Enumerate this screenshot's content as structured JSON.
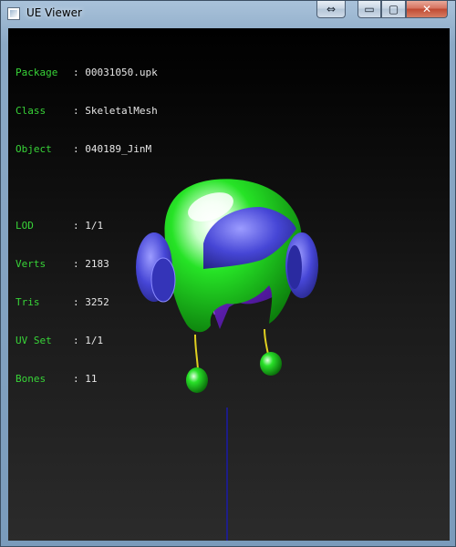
{
  "window": {
    "title": "UE Viewer",
    "controls": {
      "restore_swap": "⇔",
      "minimize": "▭",
      "maximize": "▢",
      "close": "✕"
    }
  },
  "info": {
    "object_block": [
      {
        "label": "Package",
        "sep": ":",
        "value": "00031050.upk"
      },
      {
        "label": "Class",
        "sep": ":",
        "value": "SkeletalMesh"
      },
      {
        "label": "Object",
        "sep": ":",
        "value": "040189_JinM"
      }
    ],
    "stats_block": [
      {
        "label": "LOD",
        "sep": ":",
        "value": "1/1"
      },
      {
        "label": "Verts",
        "sep": ":",
        "value": "2183"
      },
      {
        "label": "Tris",
        "sep": ":",
        "value": "3252"
      },
      {
        "label": "UV Set",
        "sep": ":",
        "value": "1/1"
      },
      {
        "label": "Bones",
        "sep": ":",
        "value": "11"
      }
    ]
  },
  "colors": {
    "label_green": "#38d438",
    "value_white": "#e6e6e6",
    "mesh_green": "#1fd21f",
    "mesh_blue": "#3f3fc8",
    "axis_blue": "#1a1aa8"
  }
}
